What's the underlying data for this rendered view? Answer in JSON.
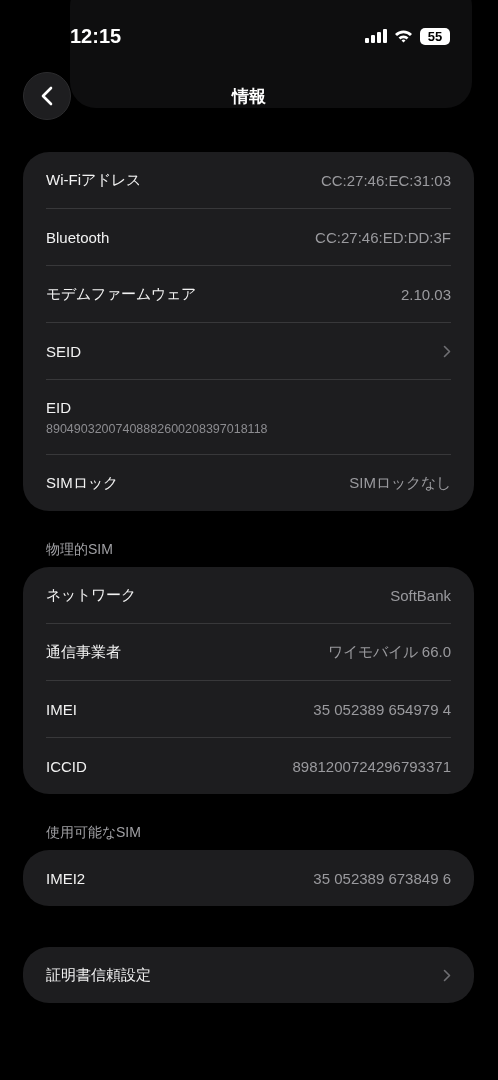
{
  "status_bar": {
    "time": "12:15",
    "battery": "55"
  },
  "nav": {
    "title": "情報"
  },
  "sections": [
    {
      "rows": [
        {
          "kind": "value",
          "label": "Wi-Fiアドレス",
          "value": "CC:27:46:EC:31:03"
        },
        {
          "kind": "value",
          "label": "Bluetooth",
          "value": "CC:27:46:ED:DD:3F"
        },
        {
          "kind": "value",
          "label": "モデムファームウェア",
          "value": "2.10.03"
        },
        {
          "kind": "link",
          "label": "SEID"
        },
        {
          "kind": "stacked",
          "label": "EID",
          "value": "89049032007408882600208397018118"
        },
        {
          "kind": "value",
          "label": "SIMロック",
          "value": "SIMロックなし"
        }
      ]
    },
    {
      "header": "物理的SIM",
      "rows": [
        {
          "kind": "value",
          "label": "ネットワーク",
          "value": "SoftBank"
        },
        {
          "kind": "value",
          "label": "通信事業者",
          "value": "ワイモバイル 66.0"
        },
        {
          "kind": "value",
          "label": "IMEI",
          "value": "35 052389 654979 4"
        },
        {
          "kind": "value",
          "label": "ICCID",
          "value": "8981200724296793371"
        }
      ]
    },
    {
      "header": "使用可能なSIM",
      "rows": [
        {
          "kind": "value",
          "label": "IMEI2",
          "value": "35 052389 673849 6"
        }
      ]
    },
    {
      "rows": [
        {
          "kind": "link",
          "label": "証明書信頼設定"
        }
      ]
    }
  ]
}
